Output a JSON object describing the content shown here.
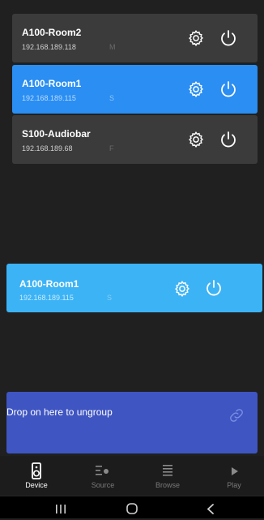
{
  "devices": [
    {
      "name": "A100-Room2",
      "ip": "192.168.189.118",
      "role": "M"
    },
    {
      "name": "A100-Room1",
      "ip": "192.168.189.115",
      "role": "S"
    },
    {
      "name": "S100-Audiobar",
      "ip": "192.168.189.68",
      "role": "F"
    }
  ],
  "dragging": {
    "name": "A100-Room1",
    "ip": "192.168.189.115",
    "role": "S"
  },
  "ungroup": {
    "label": "Drop on here to ungroup"
  },
  "tabs": [
    {
      "label": "Device",
      "icon": "speaker-icon",
      "active": true
    },
    {
      "label": "Source",
      "icon": "source-icon",
      "active": false
    },
    {
      "label": "Browse",
      "icon": "browse-icon",
      "active": false
    },
    {
      "label": "Play",
      "icon": "play-icon",
      "active": false
    }
  ],
  "colors": {
    "background": "#202020",
    "card": "#3b3b3b",
    "selected": "#2a8ef2",
    "dragging": "#3cb3f5",
    "ungroup_zone": "#3f55c1"
  }
}
